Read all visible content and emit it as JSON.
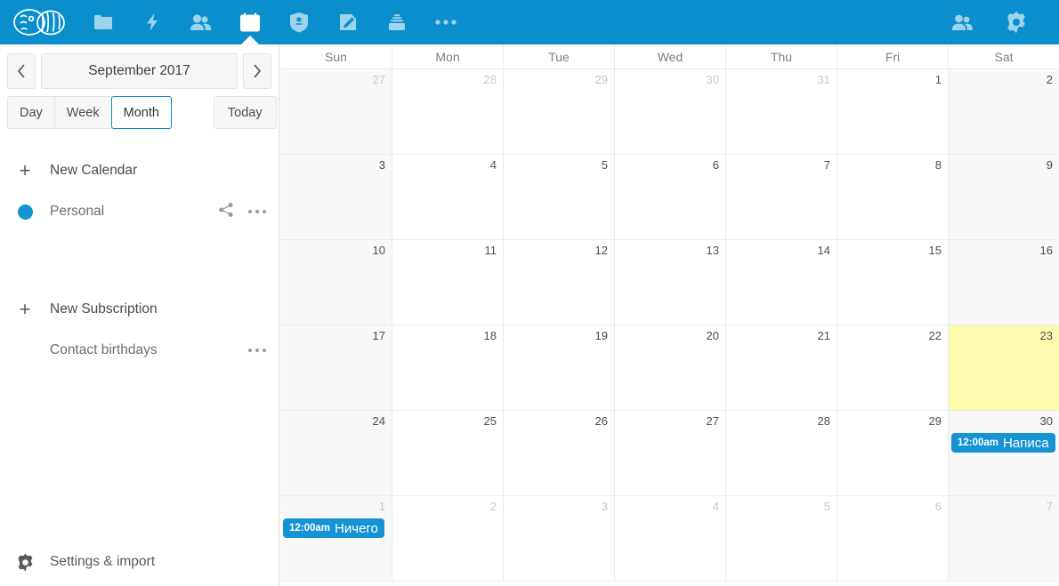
{
  "topbar": {
    "logo_name": "nextcloud-logo",
    "nav": [
      {
        "name": "files-icon",
        "label": "Files",
        "active": false
      },
      {
        "name": "activity-icon",
        "label": "Activity",
        "active": false
      },
      {
        "name": "contacts-icon",
        "label": "Contacts",
        "active": false
      },
      {
        "name": "calendar-icon",
        "label": "Calendar",
        "active": true
      },
      {
        "name": "passwords-icon",
        "label": "Passwords",
        "active": false
      },
      {
        "name": "notes-icon",
        "label": "Notes",
        "active": false
      },
      {
        "name": "deck-icon",
        "label": "Deck",
        "active": false
      },
      {
        "name": "more-apps-icon",
        "label": "More apps",
        "active": false
      }
    ],
    "right": [
      {
        "name": "contacts-menu-icon",
        "label": "Contacts"
      },
      {
        "name": "settings-gear-icon",
        "label": "Settings"
      }
    ],
    "accent_color": "#0a8fcc"
  },
  "sidebar": {
    "datenav": {
      "prev_label": "‹",
      "next_label": "›",
      "current_period": "September 2017"
    },
    "views": [
      {
        "label": "Day",
        "selected": false
      },
      {
        "label": "Week",
        "selected": false
      },
      {
        "label": "Month",
        "selected": true
      }
    ],
    "today_label": "Today",
    "rows": [
      {
        "label": "New Calendar",
        "lead": "plus",
        "share": false,
        "menu": false,
        "dark": true
      },
      {
        "label": "Personal",
        "lead": "dot",
        "share": true,
        "menu": true,
        "dark": false,
        "color": "#1793d1"
      },
      {
        "label": "New Subscription",
        "lead": "plus",
        "share": false,
        "menu": false,
        "dark": true
      },
      {
        "label": "Contact birthdays",
        "lead": "none",
        "share": false,
        "menu": true,
        "dark": false
      }
    ],
    "settings_label": "Settings & import"
  },
  "calendar": {
    "weekdays": [
      "Sun",
      "Mon",
      "Tue",
      "Wed",
      "Thu",
      "Fri",
      "Sat"
    ],
    "today_bg": "#fcfcae",
    "event_color": "#1593d3",
    "weeks": [
      [
        {
          "num": "27",
          "other": true
        },
        {
          "num": "28",
          "other": true
        },
        {
          "num": "29",
          "other": true
        },
        {
          "num": "30",
          "other": true
        },
        {
          "num": "31",
          "other": true
        },
        {
          "num": "1",
          "other": false
        },
        {
          "num": "2",
          "other": false
        }
      ],
      [
        {
          "num": "3",
          "other": false
        },
        {
          "num": "4",
          "other": false
        },
        {
          "num": "5",
          "other": false
        },
        {
          "num": "6",
          "other": false
        },
        {
          "num": "7",
          "other": false
        },
        {
          "num": "8",
          "other": false
        },
        {
          "num": "9",
          "other": false
        }
      ],
      [
        {
          "num": "10",
          "other": false
        },
        {
          "num": "11",
          "other": false
        },
        {
          "num": "12",
          "other": false
        },
        {
          "num": "13",
          "other": false
        },
        {
          "num": "14",
          "other": false
        },
        {
          "num": "15",
          "other": false
        },
        {
          "num": "16",
          "other": false
        }
      ],
      [
        {
          "num": "17",
          "other": false
        },
        {
          "num": "18",
          "other": false
        },
        {
          "num": "19",
          "other": false
        },
        {
          "num": "20",
          "other": false
        },
        {
          "num": "21",
          "other": false
        },
        {
          "num": "22",
          "other": false
        },
        {
          "num": "23",
          "other": false,
          "today": true
        }
      ],
      [
        {
          "num": "24",
          "other": false
        },
        {
          "num": "25",
          "other": false
        },
        {
          "num": "26",
          "other": false
        },
        {
          "num": "27",
          "other": false
        },
        {
          "num": "28",
          "other": false
        },
        {
          "num": "29",
          "other": false
        },
        {
          "num": "30",
          "other": false,
          "event": {
            "time": "12:00am",
            "title": "Написа"
          }
        }
      ],
      [
        {
          "num": "1",
          "other": true,
          "event": {
            "time": "12:00am",
            "title": "Ничего"
          }
        },
        {
          "num": "2",
          "other": true
        },
        {
          "num": "3",
          "other": true
        },
        {
          "num": "4",
          "other": true
        },
        {
          "num": "5",
          "other": true
        },
        {
          "num": "6",
          "other": true
        },
        {
          "num": "7",
          "other": true
        }
      ]
    ]
  }
}
